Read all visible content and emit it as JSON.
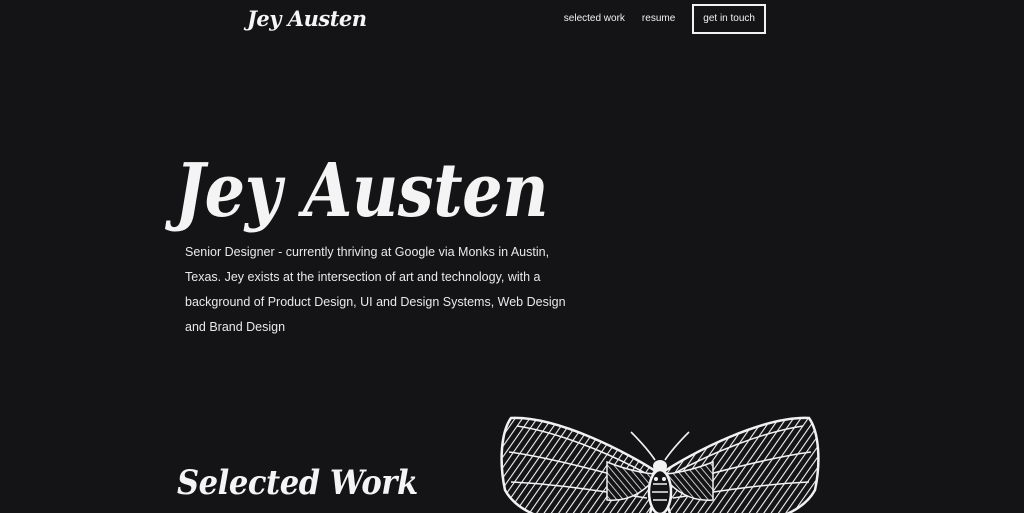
{
  "header": {
    "logo": "Jey Austen",
    "nav": {
      "selected_work": "selected work",
      "resume": "resume",
      "get_in_touch": "get in touch"
    }
  },
  "hero": {
    "title": "Jey Austen",
    "bio": "Senior Designer - currently thriving at Google via Monks in Austin, Texas. Jey exists at the intersection of art and technology, with a background of Product Design, UI and Design Systems, Web Design and Brand Design"
  },
  "sections": {
    "selected_work_title": "Selected Work"
  },
  "icons": {
    "hero_art": "moth-illustration"
  },
  "colors": {
    "background": "#141417",
    "text": "#f2f2f2"
  }
}
